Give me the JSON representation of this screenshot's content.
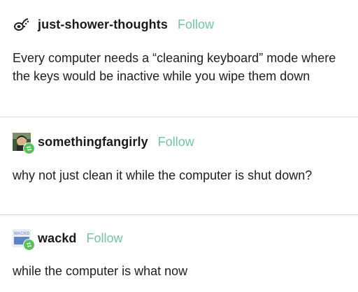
{
  "posts": [
    {
      "username": "just-shower-thoughts",
      "follow_label": "Follow",
      "text": "Every computer needs a “cleaning keyboard” mode where the keys would be inactive while you wipe them down"
    },
    {
      "username": "somethingfangirly",
      "follow_label": "Follow",
      "text": "why not just clean it while the computer is shut down?"
    },
    {
      "username": "wackd",
      "follow_label": "Follow",
      "avatar_text": "WACKD",
      "text": "while the computer is what now"
    }
  ],
  "colors": {
    "follow": "#6ec6a4",
    "reblog_badge": "#56c35a",
    "divider": "#d8d8d8"
  },
  "icons": {
    "post1_avatar": "shower-thought-avatar-icon",
    "post2_avatar": "character-avatar-icon",
    "post3_avatar": "wackd-logo-avatar-icon",
    "reblog": "reblog-icon"
  }
}
